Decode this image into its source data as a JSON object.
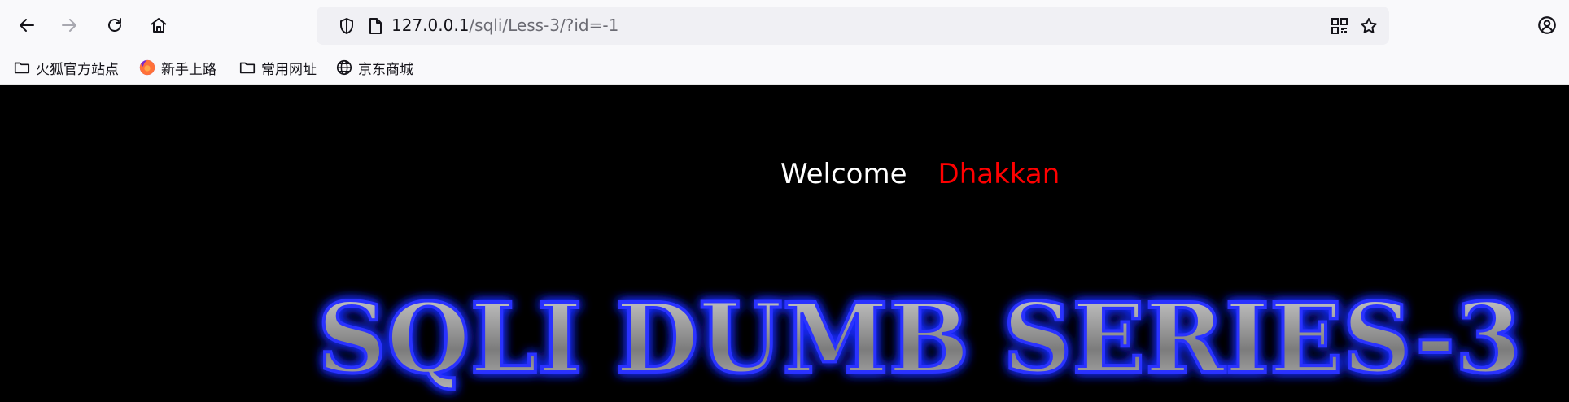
{
  "browser": {
    "url_domain": "127.0.0.1",
    "url_path": "/sqli/Less-3/?id=-1",
    "toolbar_icons": [
      "back-arrow-icon",
      "forward-arrow-icon",
      "reload-icon",
      "home-icon"
    ],
    "bookmarks": [
      {
        "label": "火狐官方站点",
        "icon": "folder-icon"
      },
      {
        "label": "新手上路",
        "icon": "firefox-icon"
      },
      {
        "label": "常用网址",
        "icon": "folder-icon"
      },
      {
        "label": "京东商城",
        "icon": "globe-icon"
      }
    ]
  },
  "page": {
    "welcome": "Welcome",
    "name": "Dhakkan",
    "banner": "SQLI DUMB SERIES-3",
    "colors": {
      "background": "#000000",
      "welcome": "#ffffff",
      "name": "#ff0000",
      "banner_glow": "#1a2cff",
      "banner_metal": "#9a9a9a"
    }
  }
}
